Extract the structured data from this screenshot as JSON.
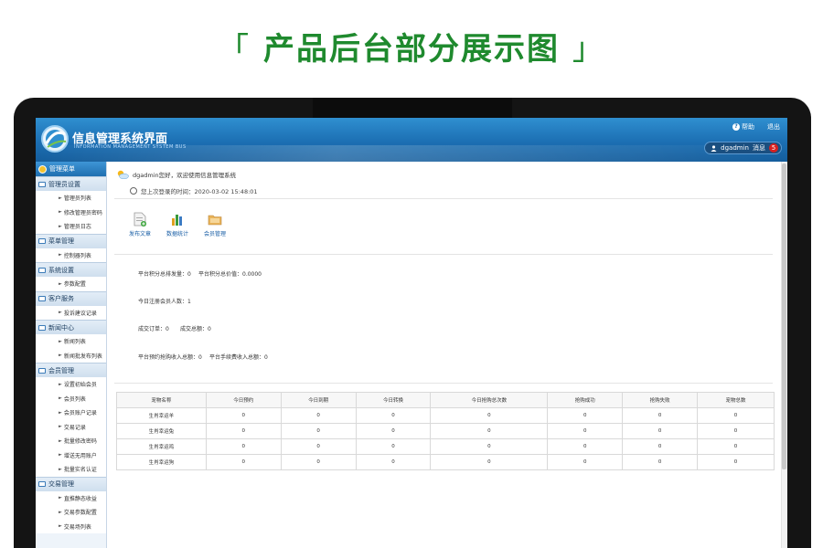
{
  "banner": {
    "text": "产品后台部分展示图",
    "left_bracket": "「",
    "right_bracket": "」"
  },
  "colors": {
    "banner_green": "#1f8a2e",
    "header_blue": "#1c6fb3",
    "badge_red": "#d82020",
    "link_blue": "#1a5fa6"
  },
  "header": {
    "title": "信息管理系统界面",
    "subtitle": "INFORMATION MANAGEMENT SYSTEM BUS",
    "help_label": "帮助",
    "logout_label": "退出",
    "username": "dgadmin",
    "messages_label": "消息",
    "message_count": "5"
  },
  "sidebar": {
    "head_label": "管理菜单",
    "groups": [
      {
        "title": "管理员设置",
        "items": [
          "管理员列表",
          "修改管理员密码",
          "管理员日志"
        ]
      },
      {
        "title": "菜单管理",
        "items": [
          "控制器列表"
        ]
      },
      {
        "title": "系统设置",
        "items": [
          "参数配置"
        ]
      },
      {
        "title": "客户服务",
        "items": [
          "投诉建议记录"
        ]
      },
      {
        "title": "新闻中心",
        "items": [
          "新闻列表",
          "新闻批发布列表"
        ]
      },
      {
        "title": "会员管理",
        "items": [
          "设置初始会员",
          "会员列表",
          "会员账户记录",
          "交易记录",
          "批量修改密码",
          "增送无用账户",
          "批量实名认证"
        ]
      },
      {
        "title": "交易管理",
        "items": [
          "直推静态收益",
          "交易参数配置",
          "交易场列表"
        ]
      }
    ]
  },
  "main": {
    "welcome": "dgadmin您好，欢迎使用信息管理系统",
    "last_login": "您上次登录的时间：2020-03-02 15:48:01",
    "quick_actions": [
      {
        "label": "发布文章",
        "icon": "document-add-icon"
      },
      {
        "label": "数据统计",
        "icon": "bar-chart-icon"
      },
      {
        "label": "会员管理",
        "icon": "folder-icon"
      }
    ],
    "stats": {
      "row1a": "平台积分总排发量：0",
      "row1b": "平台积分总价值：0.0000",
      "row2": "今日注册会员人数：1",
      "row3a": "成交订单：0",
      "row3b": "成交总额：0",
      "row4a": "平台预约抢购收入总额：0",
      "row4b": "平台手续费收入总额：0"
    },
    "table": {
      "headers": [
        "宠物名称",
        "今日预约",
        "今日到期",
        "今日转换",
        "今日抢购总次数",
        "抢购成功",
        "抢购失败",
        "宠物总数"
      ],
      "rows": [
        [
          "生肖幸运羊",
          "0",
          "0",
          "0",
          "0",
          "0",
          "0",
          "0"
        ],
        [
          "生肖幸运兔",
          "0",
          "0",
          "0",
          "0",
          "0",
          "0",
          "0"
        ],
        [
          "生肖幸运鸡",
          "0",
          "0",
          "0",
          "0",
          "0",
          "0",
          "0"
        ],
        [
          "生肖幸运狗",
          "0",
          "0",
          "0",
          "0",
          "0",
          "0",
          "0"
        ]
      ]
    }
  }
}
